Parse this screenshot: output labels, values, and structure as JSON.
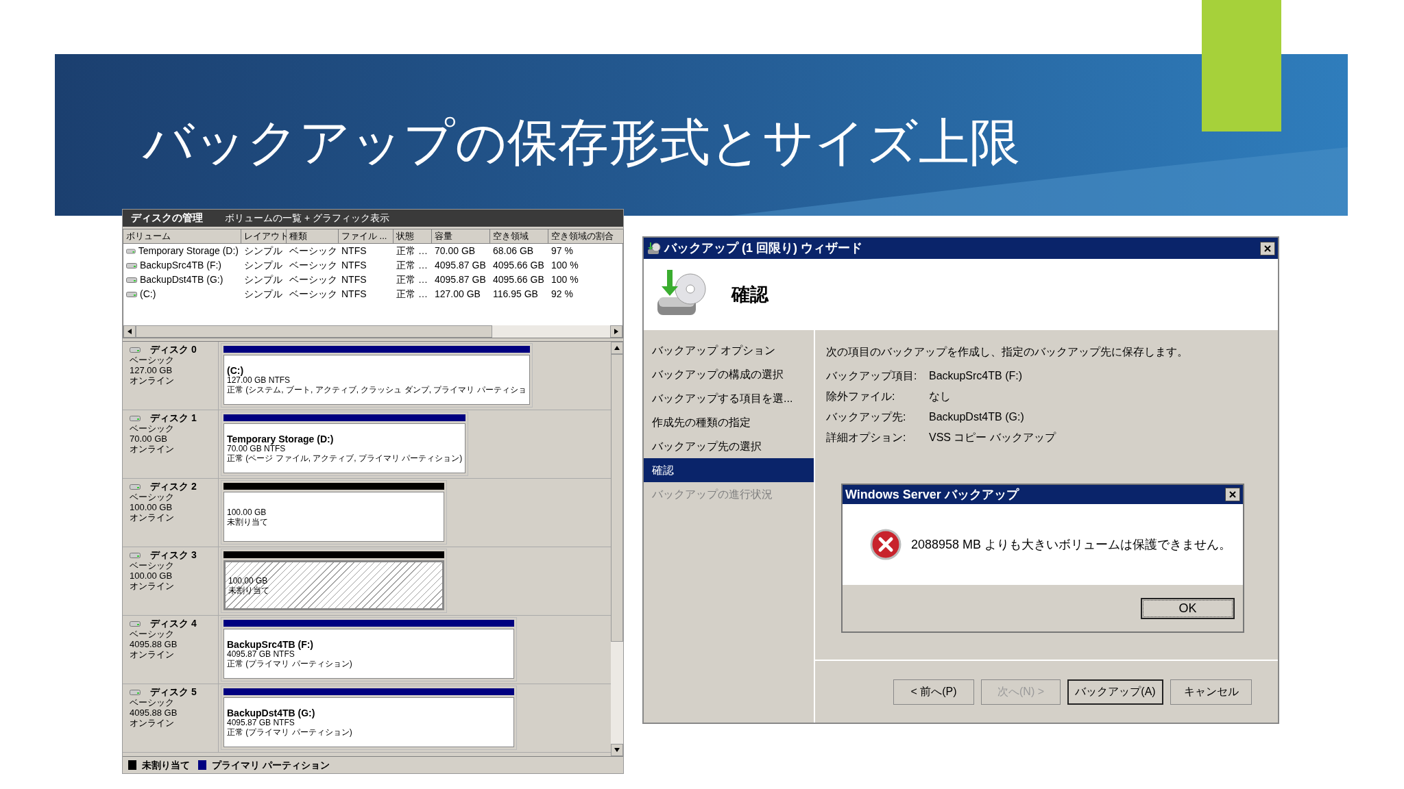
{
  "slide": {
    "title": "バックアップの保存形式とサイズ上限"
  },
  "disk_management": {
    "title": "ディスクの管理",
    "view": "ボリュームの一覧 + グラフィック表示",
    "columns": [
      "ボリューム",
      "レイアウト",
      "種類",
      "ファイル ...",
      "状態",
      "容量",
      "空き領域",
      "空き領域の割合"
    ],
    "rows": [
      {
        "cells": [
          "Temporary Storage (D:)",
          "シンプル",
          "ベーシック",
          "NTFS",
          "正常 …",
          "70.00 GB",
          "68.06 GB",
          "97 %"
        ]
      },
      {
        "cells": [
          "BackupSrc4TB (F:)",
          "シンプル",
          "ベーシック",
          "NTFS",
          "正常 …",
          "4095.87 GB",
          "4095.66 GB",
          "100 %"
        ]
      },
      {
        "cells": [
          "BackupDst4TB (G:)",
          "シンプル",
          "ベーシック",
          "NTFS",
          "正常 …",
          "4095.87 GB",
          "4095.66 GB",
          "100 %"
        ]
      },
      {
        "cells": [
          "(C:)",
          "シンプル",
          "ベーシック",
          "NTFS",
          "正常 …",
          "127.00 GB",
          "116.95 GB",
          "92 %"
        ]
      }
    ],
    "disks": [
      {
        "name": "ディスク 0",
        "type": "ベーシック",
        "size": "127.00 GB",
        "status": "オンライン",
        "partition": {
          "kind": "primary",
          "selected": false,
          "label": "(C:)",
          "detail": "127.00 GB NTFS",
          "state": "正常 (システム, ブート, アクティブ, クラッシュ ダンプ, プライマリ パーティショ"
        }
      },
      {
        "name": "ディスク 1",
        "type": "ベーシック",
        "size": "70.00 GB",
        "status": "オンライン",
        "partition": {
          "kind": "primary",
          "selected": false,
          "label": "Temporary Storage  (D:)",
          "detail": "70.00 GB NTFS",
          "state": "正常 (ページ ファイル, アクティブ, プライマリ パーティション)"
        }
      },
      {
        "name": "ディスク 2",
        "type": "ベーシック",
        "size": "100.00 GB",
        "status": "オンライン",
        "partition": {
          "kind": "unallocated",
          "selected": false,
          "detail": "100.00 GB",
          "state": "未割り当て"
        }
      },
      {
        "name": "ディスク 3",
        "type": "ベーシック",
        "size": "100.00 GB",
        "status": "オンライン",
        "partition": {
          "kind": "unallocated",
          "selected": true,
          "detail": "100.00 GB",
          "state": "未割り当て"
        }
      },
      {
        "name": "ディスク 4",
        "type": "ベーシック",
        "size": "4095.88 GB",
        "status": "オンライン",
        "partition": {
          "kind": "primary",
          "selected": false,
          "label": "BackupSrc4TB  (F:)",
          "detail": "4095.87 GB NTFS",
          "state": "正常 (プライマリ パーティション)"
        }
      },
      {
        "name": "ディスク 5",
        "type": "ベーシック",
        "size": "4095.88 GB",
        "status": "オンライン",
        "partition": {
          "kind": "primary",
          "selected": false,
          "label": "BackupDst4TB  (G:)",
          "detail": "4095.87 GB NTFS",
          "state": "正常 (プライマリ パーティション)"
        }
      }
    ],
    "legend": [
      {
        "label": "未割り当て",
        "color": "#000000"
      },
      {
        "label": "プライマリ パーティション",
        "color": "#000080"
      }
    ]
  },
  "wizard": {
    "title": "バックアップ (1 回限り) ウィザード",
    "heading": "確認",
    "nav": [
      {
        "label": "バックアップ オプション",
        "selected": false,
        "disabled": false
      },
      {
        "label": "バックアップの構成の選択",
        "selected": false,
        "disabled": false
      },
      {
        "label": "バックアップする項目を選...",
        "selected": false,
        "disabled": false
      },
      {
        "label": "作成先の種類の指定",
        "selected": false,
        "disabled": false
      },
      {
        "label": "バックアップ先の選択",
        "selected": false,
        "disabled": false
      },
      {
        "label": "確認",
        "selected": true,
        "disabled": false
      },
      {
        "label": "バックアップの進行状況",
        "selected": false,
        "disabled": true
      }
    ],
    "description": "次の項目のバックアップを作成し、指定のバックアップ先に保存します。",
    "details": [
      {
        "label": "バックアップ項目:",
        "value": "BackupSrc4TB (F:)"
      },
      {
        "label": "除外ファイル:",
        "value": "なし"
      },
      {
        "label": "バックアップ先:",
        "value": "BackupDst4TB (G:)"
      },
      {
        "label": "詳細オプション:",
        "value": "VSS コピー バックアップ"
      }
    ],
    "buttons": [
      {
        "label": "< 前へ(P)",
        "disabled": false,
        "default": false
      },
      {
        "label": "次へ(N) >",
        "disabled": true,
        "default": false
      },
      {
        "label": "バックアップ(A)",
        "disabled": false,
        "default": true
      },
      {
        "label": "キャンセル",
        "disabled": false,
        "default": false
      }
    ],
    "error_dialog": {
      "title": "Windows Server バックアップ",
      "message": "2088958 MB よりも大きいボリュームは保護できません。",
      "button": {
        "label": "OK",
        "default": true
      }
    }
  }
}
